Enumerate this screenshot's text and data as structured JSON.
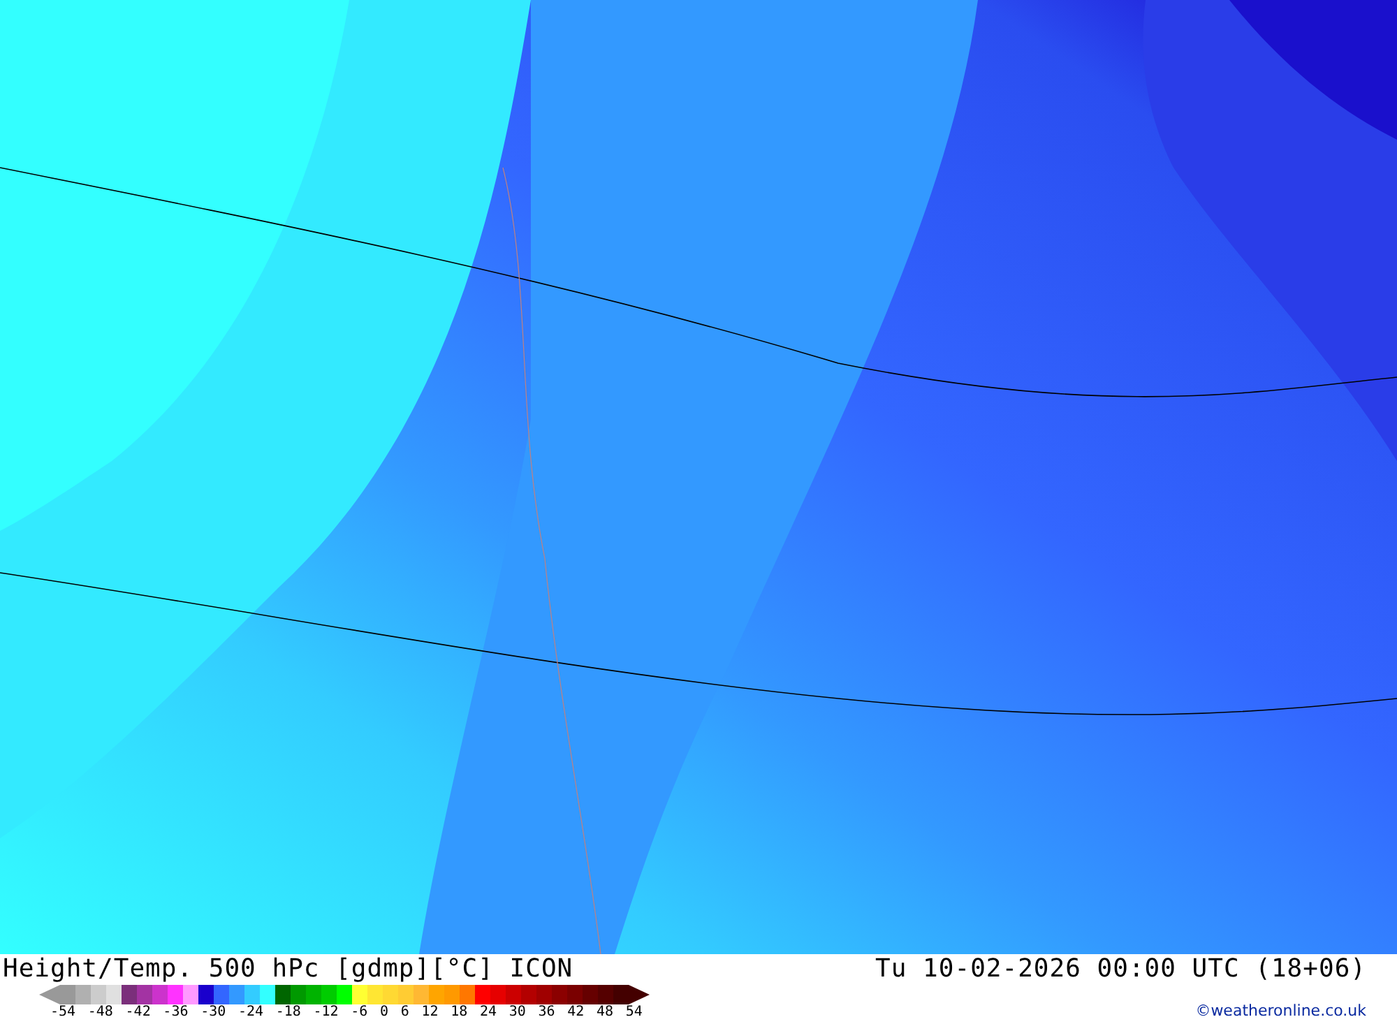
{
  "title": "Height/Temp. 500 hPc [gdmp][°C] ICON",
  "valid_time": "Tu 10-02-2026 00:00 UTC (18+06)",
  "legend": {
    "swatches": [
      {
        "color": "#999999"
      },
      {
        "color": "#b0b0b0"
      },
      {
        "color": "#cccccc"
      },
      {
        "color": "#e0e0e0"
      },
      {
        "color": "#7b2f7b"
      },
      {
        "color": "#a333a3"
      },
      {
        "color": "#cc33cc"
      },
      {
        "color": "#ff33ff"
      },
      {
        "color": "#ff99ff"
      },
      {
        "color": "#1a00cc"
      },
      {
        "color": "#3366ff"
      },
      {
        "color": "#3399ff"
      },
      {
        "color": "#33ccff"
      },
      {
        "color": "#33ffff"
      },
      {
        "color": "#006600"
      },
      {
        "color": "#009900"
      },
      {
        "color": "#00b300"
      },
      {
        "color": "#00cc00"
      },
      {
        "color": "#00ff00"
      },
      {
        "color": "#ffff33"
      },
      {
        "color": "#ffe633"
      },
      {
        "color": "#ffd933"
      },
      {
        "color": "#ffcc33"
      },
      {
        "color": "#ffb833"
      },
      {
        "color": "#ffa500"
      },
      {
        "color": "#ff9900"
      },
      {
        "color": "#ff7700"
      },
      {
        "color": "#ff0000"
      },
      {
        "color": "#e60000"
      },
      {
        "color": "#cc0000"
      },
      {
        "color": "#b30000"
      },
      {
        "color": "#a00000"
      },
      {
        "color": "#8b0000"
      },
      {
        "color": "#7a0000"
      },
      {
        "color": "#660000"
      },
      {
        "color": "#550000"
      },
      {
        "color": "#440000"
      }
    ],
    "ticks": [
      "-54",
      "-48",
      "-42",
      "-36",
      "-30",
      "-24",
      "-18",
      "-12",
      "-6",
      "0",
      "6",
      "12",
      "18",
      "24",
      "30",
      "36",
      "42",
      "48",
      "54"
    ]
  },
  "copyright": "©weatheronline.co.uk"
}
